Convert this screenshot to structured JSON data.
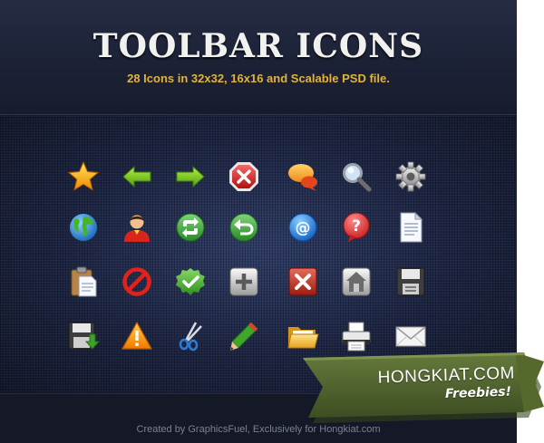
{
  "title": "TOOLBAR ICONS",
  "subtitle": "28 Icons in 32x32, 16x16 and Scalable PSD file.",
  "credit": "Created by GraphicsFuel, Exclusively for Hongkiat.com",
  "banner": {
    "brand": "HONGKIAT.COM",
    "tagline": "Freebies!"
  },
  "colors": {
    "title": "#f1f1ef",
    "subtitle": "#e2b23a",
    "background": "#1a2138",
    "ribbon": "#4b5e2a"
  },
  "icons": [
    [
      "star-icon",
      "arrow-left-icon",
      "arrow-right-icon",
      "stop-icon",
      "speech-bubble-icon",
      "magnifier-icon",
      "gear-icon"
    ],
    [
      "globe-icon",
      "user-icon",
      "refresh-icon",
      "undo-icon",
      "email-at-icon",
      "help-icon",
      "document-icon"
    ],
    [
      "clipboard-icon",
      "block-icon",
      "check-icon",
      "add-icon",
      "delete-icon",
      "home-icon",
      "save-icon"
    ],
    [
      "download-icon",
      "warning-icon",
      "scissors-icon",
      "pencil-icon",
      "folder-icon",
      "printer-icon",
      "mail-icon"
    ]
  ]
}
